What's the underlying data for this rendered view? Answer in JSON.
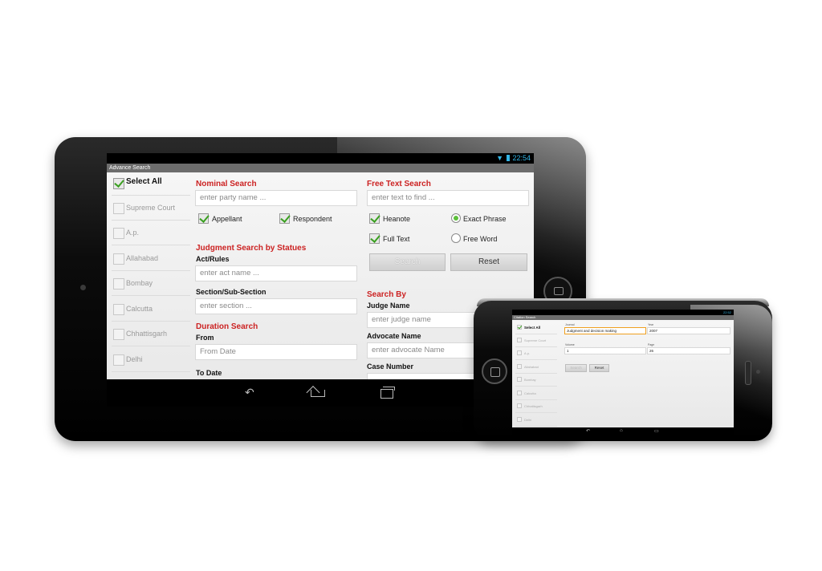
{
  "tablet": {
    "status_time": "22:54",
    "app_title": "Advance Search",
    "sidebar": [
      {
        "label": "Select All",
        "checked": true
      },
      {
        "label": "Supreme Court",
        "checked": false
      },
      {
        "label": "A.p.",
        "checked": false
      },
      {
        "label": "Allahabad",
        "checked": false
      },
      {
        "label": "Bombay",
        "checked": false
      },
      {
        "label": "Calcutta",
        "checked": false
      },
      {
        "label": "Chhattisgarh",
        "checked": false
      },
      {
        "label": "Delhi",
        "checked": false
      }
    ],
    "nominal": {
      "heading": "Nominal Search",
      "party_placeholder": "enter party name ...",
      "appellant": "Appellant",
      "respondent": "Respondent"
    },
    "statutes": {
      "heading": "Judgment Search by Statues",
      "act_label": "Act/Rules",
      "act_placeholder": "enter act name ...",
      "section_label": "Section/Sub-Section",
      "section_placeholder": "enter section ..."
    },
    "duration": {
      "heading": "Duration Search",
      "from_label": "From",
      "from_placeholder": "From Date",
      "to_label": "To Date"
    },
    "freetext": {
      "heading": "Free Text Search",
      "text_placeholder": "enter text to find ...",
      "headnote": "Heanote",
      "exact_phrase": "Exact Phrase",
      "full_text": "Full Text",
      "free_word": "Free Word",
      "search": "Search",
      "reset": "Reset"
    },
    "searchby": {
      "heading": "Search By",
      "judge_label": "Judge Name",
      "judge_placeholder": "enter judge name",
      "advocate_label": "Advocate Name",
      "advocate_placeholder": "enter advocate Name",
      "case_label": "Case Number"
    }
  },
  "phone": {
    "status_time": "22:52",
    "app_title": "Citation Search",
    "sidebar": [
      {
        "label": "Select All",
        "checked": true
      },
      {
        "label": "Supreme Court",
        "checked": false
      },
      {
        "label": "A.p.",
        "checked": false
      },
      {
        "label": "Allahabad",
        "checked": false
      },
      {
        "label": "Bombay",
        "checked": false
      },
      {
        "label": "Calcutta",
        "checked": false
      },
      {
        "label": "Chhattisgarh",
        "checked": false
      },
      {
        "label": "Delhi",
        "checked": false
      }
    ],
    "journal_label": "Journal",
    "journal_value": "Judgment and decision making",
    "year_label": "Year",
    "year_value": "2007",
    "volume_label": "Volume",
    "volume_value": "1",
    "page_label": "Page",
    "page_value": "26",
    "search": "Search",
    "reset": "Reset"
  }
}
